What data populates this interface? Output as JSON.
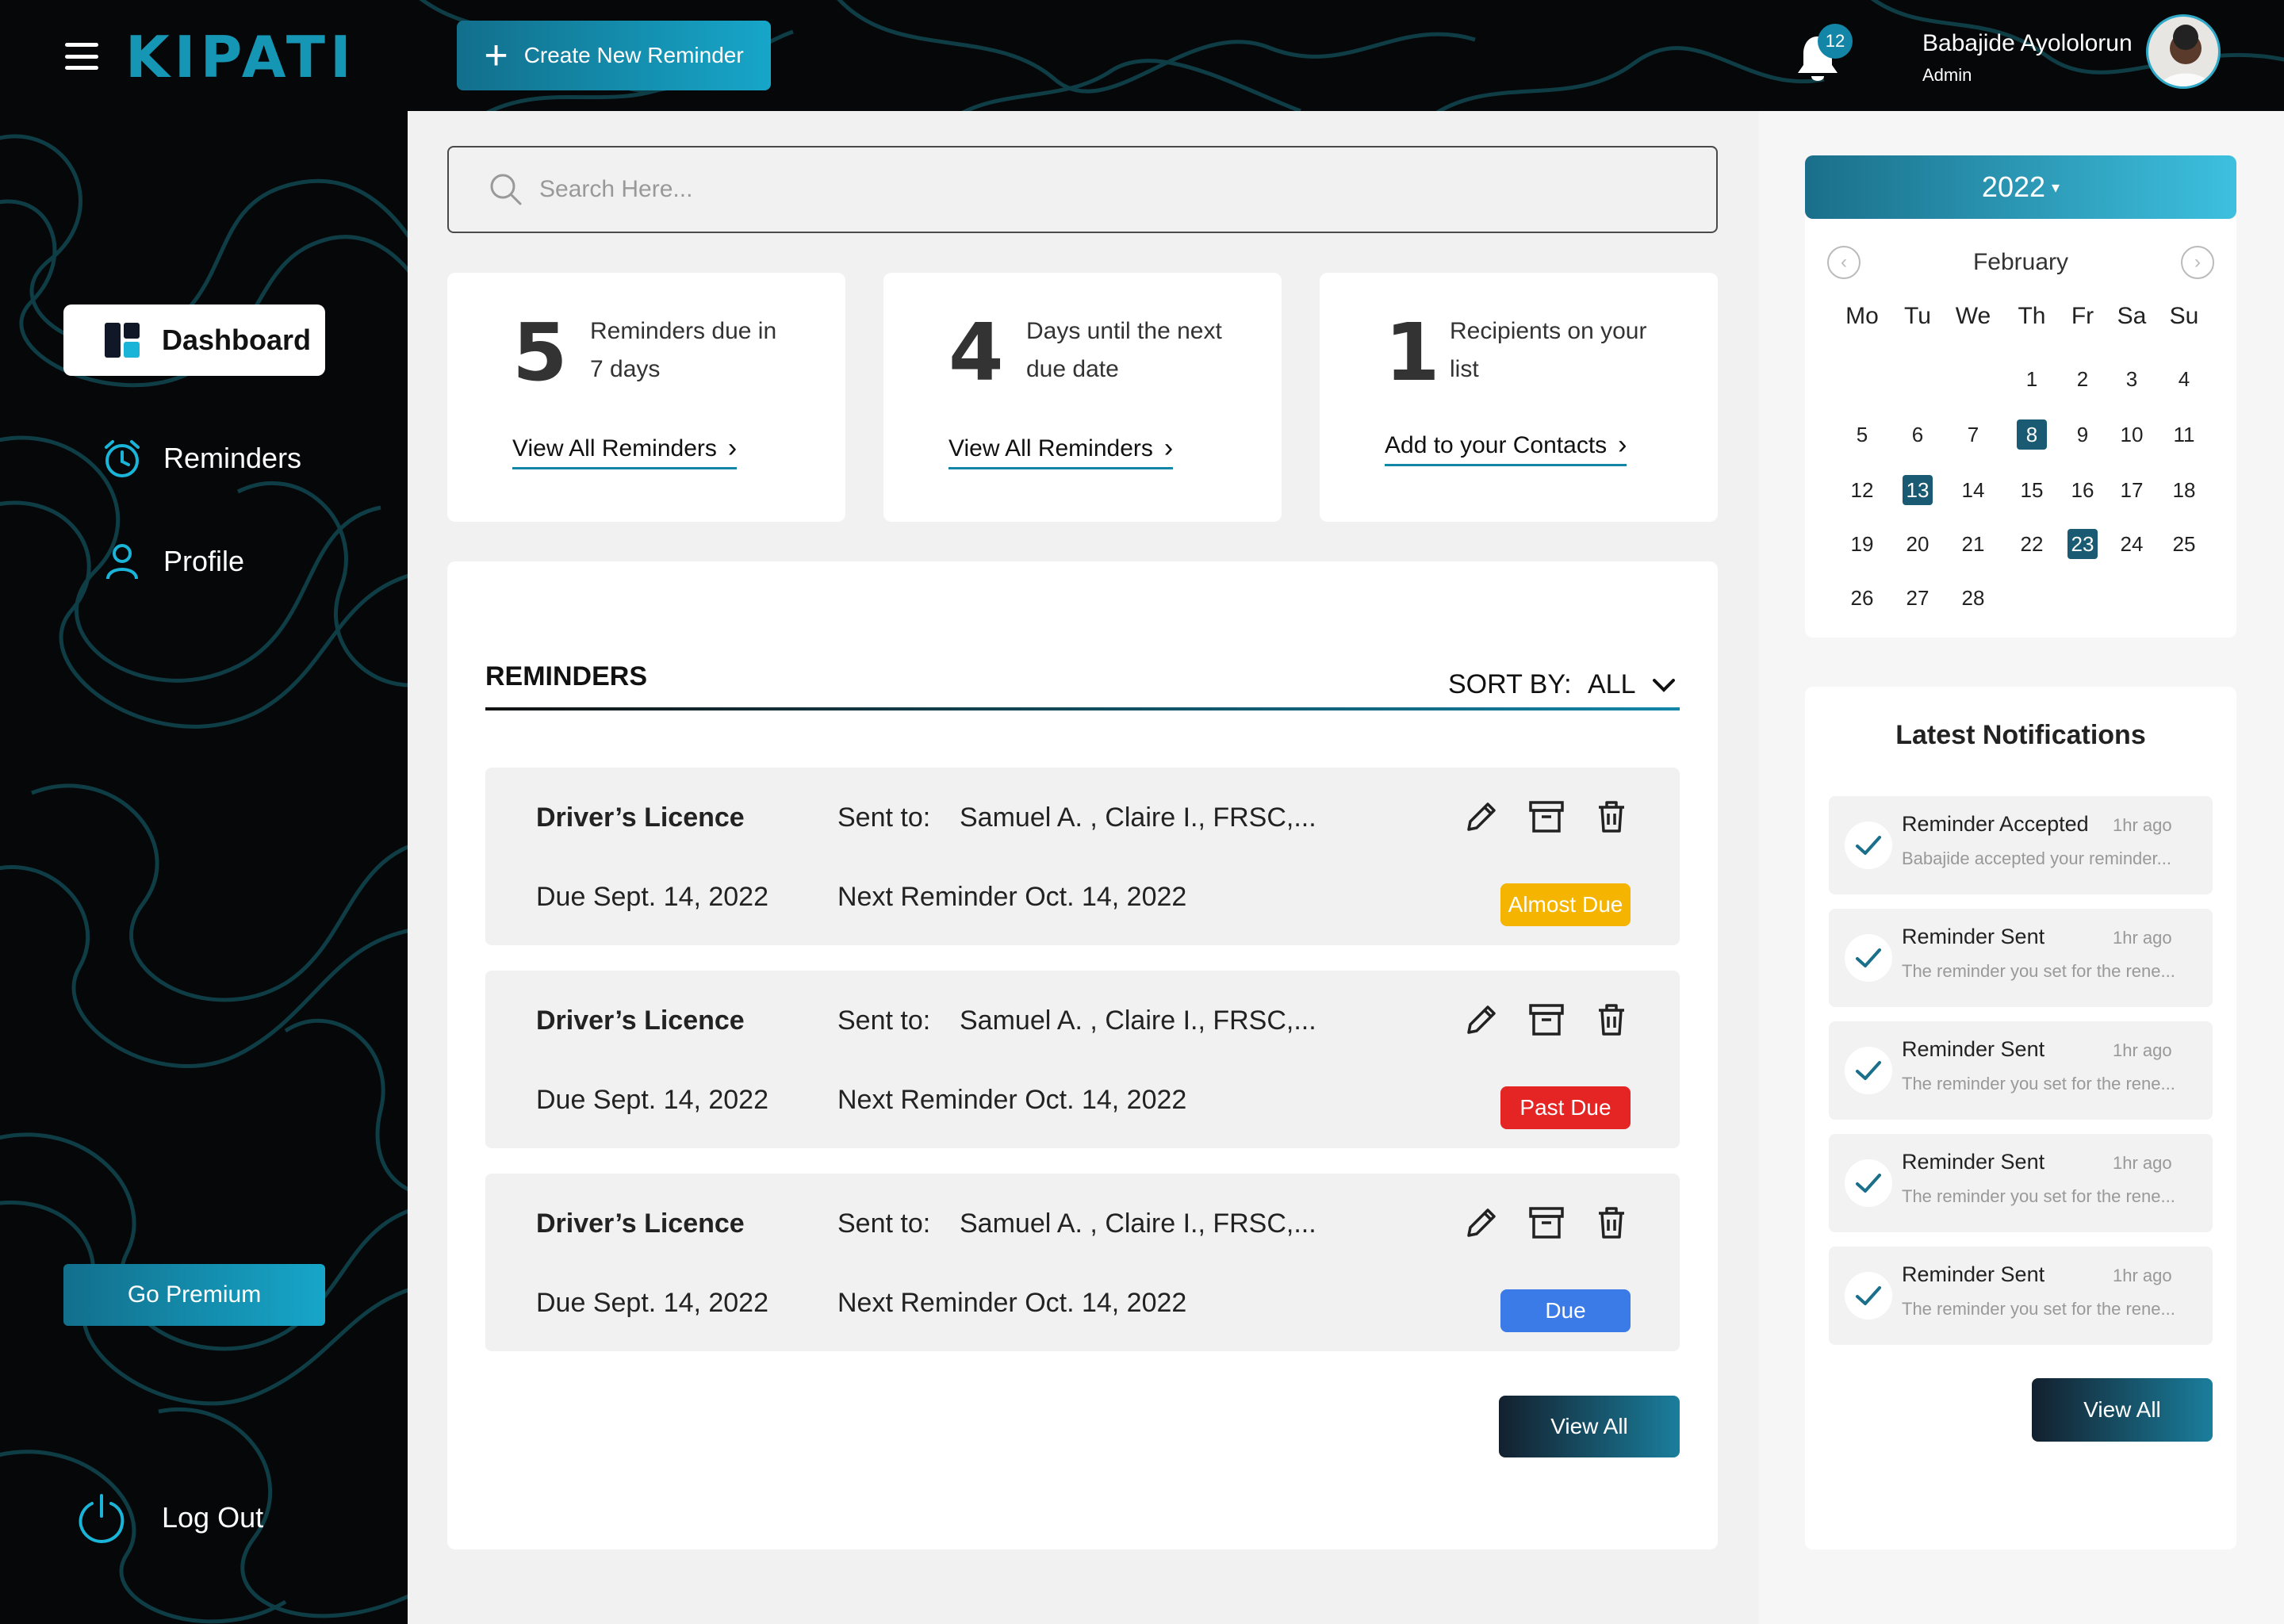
{
  "header": {
    "logo": "KIPATI",
    "create_button": "Create New Reminder",
    "notification_count": "12",
    "user_name": "Babajide Ayololorun",
    "user_role": "Admin"
  },
  "sidebar": {
    "items": [
      {
        "label": "Dashboard",
        "icon": "dashboard-icon"
      },
      {
        "label": "Reminders",
        "icon": "alarm-clock-icon"
      },
      {
        "label": "Profile",
        "icon": "user-icon"
      }
    ],
    "premium_button": "Go Premium",
    "logout": "Log Out"
  },
  "search": {
    "placeholder": "Search Here..."
  },
  "stats": [
    {
      "number": "5",
      "desc": "Reminders due in 7 days",
      "link": "View All Reminders"
    },
    {
      "number": "4",
      "desc": "Days until the next due date",
      "link": "View All Reminders"
    },
    {
      "number": "1",
      "desc": "Recipients on your list",
      "link": "Add to your Contacts"
    }
  ],
  "reminders": {
    "title": "REMINDERS",
    "sort_label": "SORT BY:",
    "sort_value": "ALL",
    "rows": [
      {
        "name": "Driver’s Licence",
        "sent_label": "Sent to:",
        "recipients": "Samuel A. , Claire I., FRSC,...",
        "due": "Due Sept. 14, 2022",
        "next": "Next Reminder Oct. 14, 2022",
        "status": "Almost Due",
        "status_color": "#f5b400"
      },
      {
        "name": "Driver’s Licence",
        "sent_label": "Sent to:",
        "recipients": "Samuel A. , Claire I., FRSC,...",
        "due": "Due Sept. 14, 2022",
        "next": "Next Reminder Oct. 14, 2022",
        "status": "Past Due",
        "status_color": "#e52424"
      },
      {
        "name": "Driver’s Licence",
        "sent_label": "Sent to:",
        "recipients": "Samuel A. , Claire I., FRSC,...",
        "due": "Due Sept. 14, 2022",
        "next": "Next Reminder Oct. 14, 2022",
        "status": "Due",
        "status_color": "#3a7be8"
      }
    ],
    "view_all": "View All"
  },
  "calendar": {
    "year": "2022",
    "month": "February",
    "weekdays": [
      "Mo",
      "Tu",
      "We",
      "Th",
      "Fr",
      "Sa",
      "Su"
    ],
    "weeks": [
      [
        "",
        "",
        "",
        "1",
        "2",
        "3",
        "4"
      ],
      [
        "5",
        "6",
        "7",
        "8",
        "9",
        "10",
        "11"
      ],
      [
        "12",
        "13",
        "14",
        "15",
        "16",
        "17",
        "18"
      ],
      [
        "19",
        "20",
        "21",
        "22",
        "23",
        "24",
        "25"
      ],
      [
        "26",
        "27",
        "28",
        "",
        "",
        "",
        ""
      ]
    ],
    "selected_days": [
      "8",
      "13",
      "23"
    ]
  },
  "notifications": {
    "title": "Latest Notifications",
    "items": [
      {
        "title": "Reminder Accepted",
        "time": "1hr ago",
        "body": "Babajide accepted your reminder..."
      },
      {
        "title": "Reminder Sent",
        "time": "1hr ago",
        "body": "The reminder you set for the rene..."
      },
      {
        "title": "Reminder Sent",
        "time": "1hr ago",
        "body": "The reminder you set for the rene..."
      },
      {
        "title": "Reminder Sent",
        "time": "1hr ago",
        "body": "The reminder you set for the rene..."
      },
      {
        "title": "Reminder Sent",
        "time": "1hr ago",
        "body": "The reminder you set for the rene..."
      }
    ],
    "view_all": "View All"
  },
  "colors": {
    "accent": "#1386a8",
    "sidebar_bg": "#050708",
    "almost_due": "#f5b400",
    "past_due": "#e52424",
    "due": "#3a7be8"
  }
}
